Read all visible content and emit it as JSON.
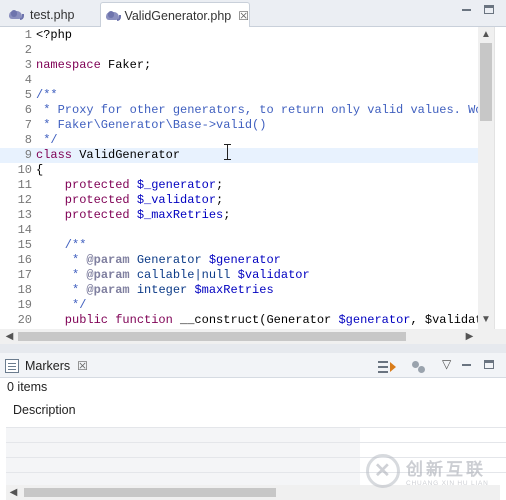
{
  "editor_tabs": [
    {
      "label": "test.php",
      "icon": "php-elephant-icon",
      "active": false
    },
    {
      "label": "ValidGenerator.php",
      "icon": "php-elephant-icon",
      "active": true,
      "close": "☒"
    }
  ],
  "code": {
    "current_line": 9,
    "lines": [
      {
        "n": "1",
        "text": "<?php"
      },
      {
        "n": "2",
        "text": ""
      },
      {
        "n": "3",
        "kw": "namespace",
        "text": " Faker;"
      },
      {
        "n": "4",
        "text": ""
      },
      {
        "n": "5",
        "cm": "/**"
      },
      {
        "n": "6",
        "cm": " * Proxy for other generators, to return only valid values. Wor"
      },
      {
        "n": "7",
        "cm": " * Faker\\Generator\\Base->valid()"
      },
      {
        "n": "8",
        "cm": " */"
      },
      {
        "n": "9",
        "kw": "class",
        "text": " ValidGenerator"
      },
      {
        "n": "10",
        "text": "{"
      },
      {
        "n": "11",
        "kw": "    protected",
        "var": " $_generator",
        "tail": ";"
      },
      {
        "n": "12",
        "kw": "    protected",
        "var": " $_validator",
        "tail": ";"
      },
      {
        "n": "13",
        "kw": "    protected",
        "var": " $_maxRetries",
        "tail": ";"
      },
      {
        "n": "14",
        "text": ""
      },
      {
        "n": "15",
        "cm": "    /**"
      },
      {
        "n": "16",
        "cm": "     * ",
        "an": "@param",
        "ty": " Generator",
        "var": " $generator"
      },
      {
        "n": "17",
        "cm": "     * ",
        "an": "@param",
        "ty": " callable|null",
        "var": " $validator"
      },
      {
        "n": "18",
        "cm": "     * ",
        "an": "@param",
        "ty": " integer",
        "var": " $maxRetries"
      },
      {
        "n": "19",
        "cm": "     */"
      },
      {
        "n": "20",
        "kw": "    public function",
        "text": " __construct(Generator ",
        "var": "$generator",
        "tail": ", $validato"
      }
    ]
  },
  "markers_view": {
    "tab_label": "Markers",
    "close": "☒",
    "items_count": "0 items",
    "column_header": "Description",
    "toolbar": {
      "filter": "filter-icon",
      "group": "group-by-icon",
      "menu": "▽",
      "minimize": "minimize-icon",
      "maximize": "maximize-icon"
    }
  },
  "watermark": {
    "cn": "创新互联",
    "en": "CHUANG XIN HU LIAN"
  }
}
